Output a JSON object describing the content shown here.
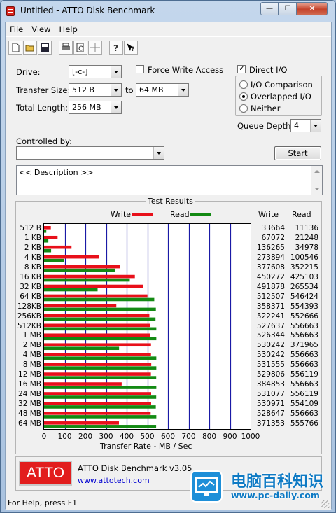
{
  "window": {
    "title": "Untitled - ATTO Disk Benchmark",
    "min": "—",
    "max": "☐",
    "close": "✕"
  },
  "menu": [
    "File",
    "View",
    "Help"
  ],
  "toolbar": [
    "new-icon",
    "open-icon",
    "save-icon",
    "print-icon",
    "print-preview-icon",
    "move-icon",
    "help-icon",
    "context-help-icon"
  ],
  "settings": {
    "drive_label": "Drive:",
    "drive_value": "[-c-]",
    "force_write_label": "Force Write Access",
    "force_write_checked": false,
    "direct_io_label": "Direct I/O",
    "direct_io_checked": true,
    "transfer_size_label": "Transfer Size:",
    "transfer_from": "512 B",
    "to_label": "to",
    "transfer_to": "64 MB",
    "total_length_label": "Total Length:",
    "total_length_value": "256 MB",
    "io_comparison_label": "I/O Comparison",
    "overlapped_io_label": "Overlapped I/O",
    "neither_label": "Neither",
    "selected_mode": "Overlapped I/O",
    "queue_depth_label": "Queue Depth:",
    "queue_depth_value": "4",
    "controlled_by_label": "Controlled by:",
    "controlled_by_value": "",
    "start_label": "Start",
    "description": "<< Description >>"
  },
  "results": {
    "title": "Test Results",
    "write_label": "Write",
    "read_label": "Read",
    "write_col": "Write",
    "read_col": "Read",
    "write_color": "#e8101a",
    "read_color": "#138a13",
    "x_axis_label": "Transfer Rate - MB / Sec"
  },
  "chart_data": {
    "type": "bar",
    "orientation": "horizontal",
    "categories": [
      "512 B",
      "1 KB",
      "2 KB",
      "4 KB",
      "8 KB",
      "16 KB",
      "32 KB",
      "64 KB",
      "128KB",
      "256KB",
      "512KB",
      "1 MB",
      "2 MB",
      "4 MB",
      "8 MB",
      "12 MB",
      "16 MB",
      "24 MB",
      "32 MB",
      "48 MB",
      "64 MB"
    ],
    "series": [
      {
        "name": "Write",
        "values": [
          33664,
          67072,
          136265,
          273894,
          377608,
          450272,
          491878,
          512507,
          358371,
          522241,
          527637,
          526344,
          530242,
          530242,
          531555,
          529806,
          384853,
          531077,
          530971,
          528647,
          371353
        ]
      },
      {
        "name": "Read",
        "values": [
          11136,
          21248,
          34978,
          100546,
          352215,
          425103,
          265534,
          546424,
          554393,
          552666,
          556663,
          556663,
          371965,
          556663,
          556663,
          556119,
          556663,
          556119,
          554109,
          556663,
          555766
        ]
      }
    ],
    "xlabel": "Transfer Rate - MB / Sec",
    "xlim": [
      0,
      1000
    ],
    "xticks": [
      0,
      100,
      200,
      300,
      400,
      500,
      600,
      700,
      800,
      900,
      1000
    ],
    "grid": true,
    "legend": "top"
  },
  "footer": {
    "logo": "ATTO",
    "product": "ATTO Disk Benchmark v3.05",
    "link": "www.attotech.com"
  },
  "status": {
    "text": "For Help, press F1"
  },
  "watermark": {
    "text": "电脑百科知识",
    "url": "www.pc-daily.com"
  }
}
